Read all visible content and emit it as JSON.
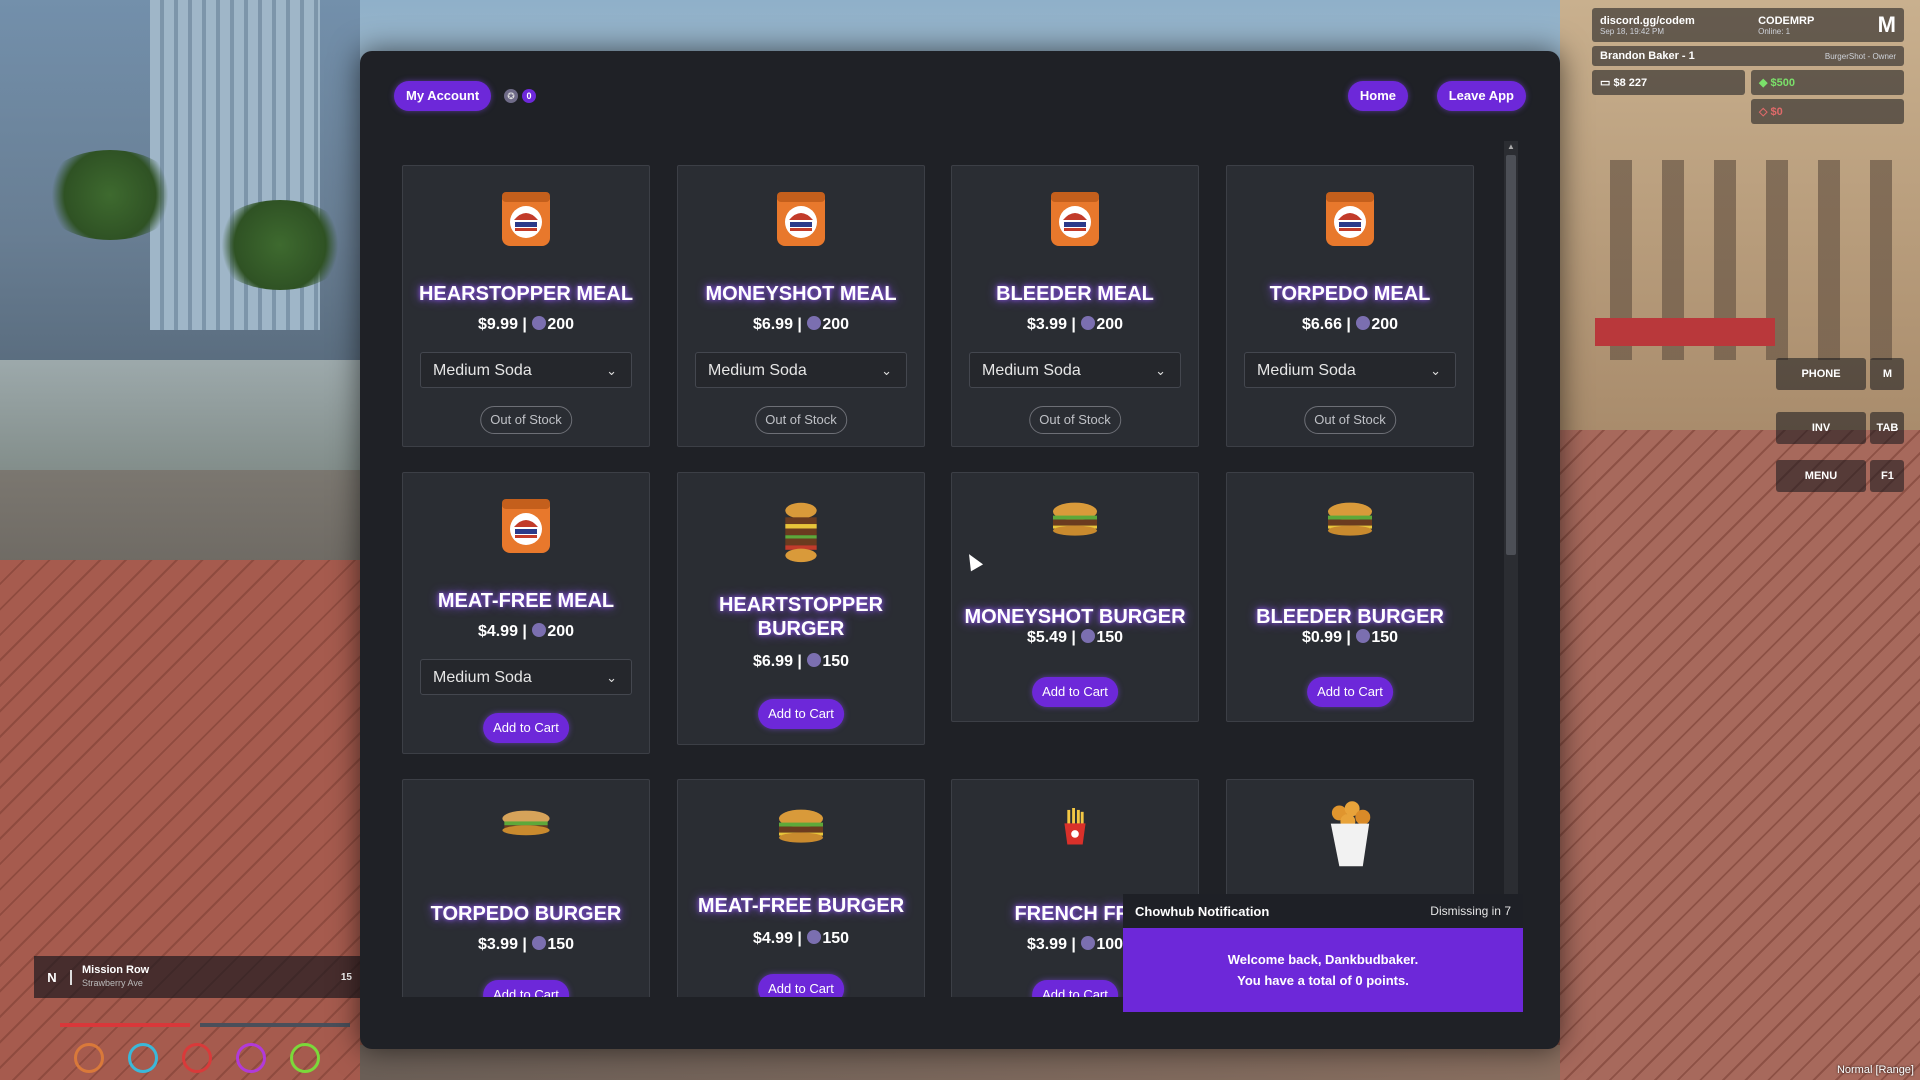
{
  "hud": {
    "discord": "discord.gg/codem",
    "discord_sub": "Sep 18, 19:42 PM",
    "server": "CODEMRP",
    "server_sub": "Online: 1",
    "player": "Brandon Baker - 1",
    "job": "BurgerShot - Owner",
    "cash": "$8 227",
    "bank": "$500",
    "dirty": "$0",
    "keys": [
      "PHONE",
      "M",
      "INV",
      "TAB",
      "MENU",
      "F1"
    ],
    "street": "Mission Row",
    "street_sub": "Strawberry Ave",
    "street_num": "15",
    "voice": "Normal [Range]"
  },
  "app": {
    "account_label": "My Account",
    "points_badge": "0",
    "home_label": "Home",
    "leave_label": "Leave App",
    "items": [
      {
        "name": "HEARSTOPPER MEAL",
        "price": "$9.99 | ",
        "points": "200",
        "option": "Medium Soda",
        "button": "Out of Stock",
        "button_type": "out",
        "icon": "meal-box-icon"
      },
      {
        "name": "MONEYSHOT MEAL",
        "price": "$6.99 | ",
        "points": "200",
        "option": "Medium Soda",
        "button": "Out of Stock",
        "button_type": "out",
        "icon": "meal-box-icon"
      },
      {
        "name": "BLEEDER MEAL",
        "price": "$3.99 | ",
        "points": "200",
        "option": "Medium Soda",
        "button": "Out of Stock",
        "button_type": "out",
        "icon": "meal-box-icon"
      },
      {
        "name": "TORPEDO MEAL",
        "price": "$6.66 | ",
        "points": "200",
        "option": "Medium Soda",
        "button": "Out of Stock",
        "button_type": "out",
        "icon": "meal-box-icon"
      },
      {
        "name": "MEAT-FREE MEAL",
        "price": "$4.99 | ",
        "points": "200",
        "option": "Medium Soda",
        "button": "Add to Cart",
        "button_type": "cart",
        "icon": "meal-box-icon"
      },
      {
        "name": "HEARTSTOPPER BURGER",
        "price": "$6.99 | ",
        "points": "150",
        "button": "Add to Cart",
        "button_type": "cart",
        "icon": "stacked-burger-icon"
      },
      {
        "name": "MONEYSHOT BURGER",
        "price": "$5.49 | ",
        "points": "150",
        "button": "Add to Cart",
        "button_type": "cart",
        "icon": "burger-icon"
      },
      {
        "name": "BLEEDER BURGER",
        "price": "$0.99 | ",
        "points": "150",
        "button": "Add to Cart",
        "button_type": "cart",
        "icon": "burger-icon"
      },
      {
        "name": "TORPEDO BURGER",
        "price": "$3.99 | ",
        "points": "150",
        "button": "Add to Cart",
        "button_type": "cart",
        "icon": "torpedo-sandwich-icon"
      },
      {
        "name": "MEAT-FREE BURGER",
        "price": "$4.99 | ",
        "points": "150",
        "button": "Add to Cart",
        "button_type": "cart",
        "icon": "burger-icon"
      },
      {
        "name": "FRENCH FRI",
        "price": "$3.99 | ",
        "points": "100",
        "button": "Add to Cart",
        "button_type": "cart",
        "icon": "fries-icon"
      },
      {
        "name": "",
        "price": "",
        "points": "",
        "icon": "nuggets-icon"
      }
    ]
  },
  "notification": {
    "title": "Chowhub Notification",
    "dismiss": "Dismissing in 7",
    "line1": "Welcome back, Dankbudbaker.",
    "line2": "You have a total of 0 points."
  },
  "colors": {
    "accent": "#6d28d9",
    "card_bg": "#2a2d33",
    "window_bg": "#1f2126",
    "glow": "#9a5cff"
  }
}
